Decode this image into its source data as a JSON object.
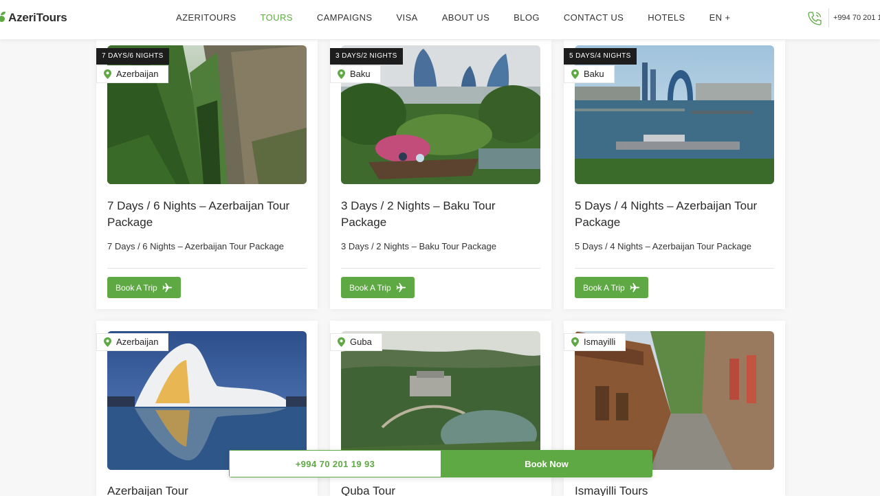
{
  "header": {
    "logo_text": "AzeriTours",
    "nav": [
      "AZERITOURS",
      "TOURS",
      "CAMPAIGNS",
      "VISA",
      "ABOUT US",
      "BLOG",
      "CONTACT US",
      "HOTELS",
      "EN +"
    ],
    "active_nav": "TOURS",
    "phone": "+994 70 201 1",
    "phone_icon": "phone-icon"
  },
  "tours": [
    {
      "duration": "7 DAYS/6 NIGHTS",
      "location": "Azerbaijan",
      "title": "7 Days / 6 Nights – Azerbaijan Tour Package",
      "subtitle": "7 Days / 6 Nights – Azerbaijan Tour Package",
      "button": "Book A Trip"
    },
    {
      "duration": "3 DAYS/2 NIGHTS",
      "location": "Baku",
      "title": "3 Days / 2 Nights – Baku Tour Package",
      "subtitle": "3 Days / 2 Nights – Baku Tour Package",
      "button": "Book A Trip"
    },
    {
      "duration": "5 DAYS/4 NIGHTS",
      "location": "Baku",
      "title": "5 Days / 4 Nights – Azerbaijan Tour Package",
      "subtitle": "5 Days / 4 Nights – Azerbaijan Tour Package",
      "button": "Book A Trip"
    },
    {
      "location": "Azerbaijan",
      "title": "Azerbaijan Tour"
    },
    {
      "location": "Guba",
      "title": "Quba Tour"
    },
    {
      "location": "Ismayilli",
      "title": "Ismayilli Tours"
    }
  ],
  "bottom_bar": {
    "phone": "+994 70 201 19 93",
    "book": "Book Now"
  },
  "colors": {
    "accent": "#5fa944",
    "badge_dark": "#1d1d1d"
  }
}
